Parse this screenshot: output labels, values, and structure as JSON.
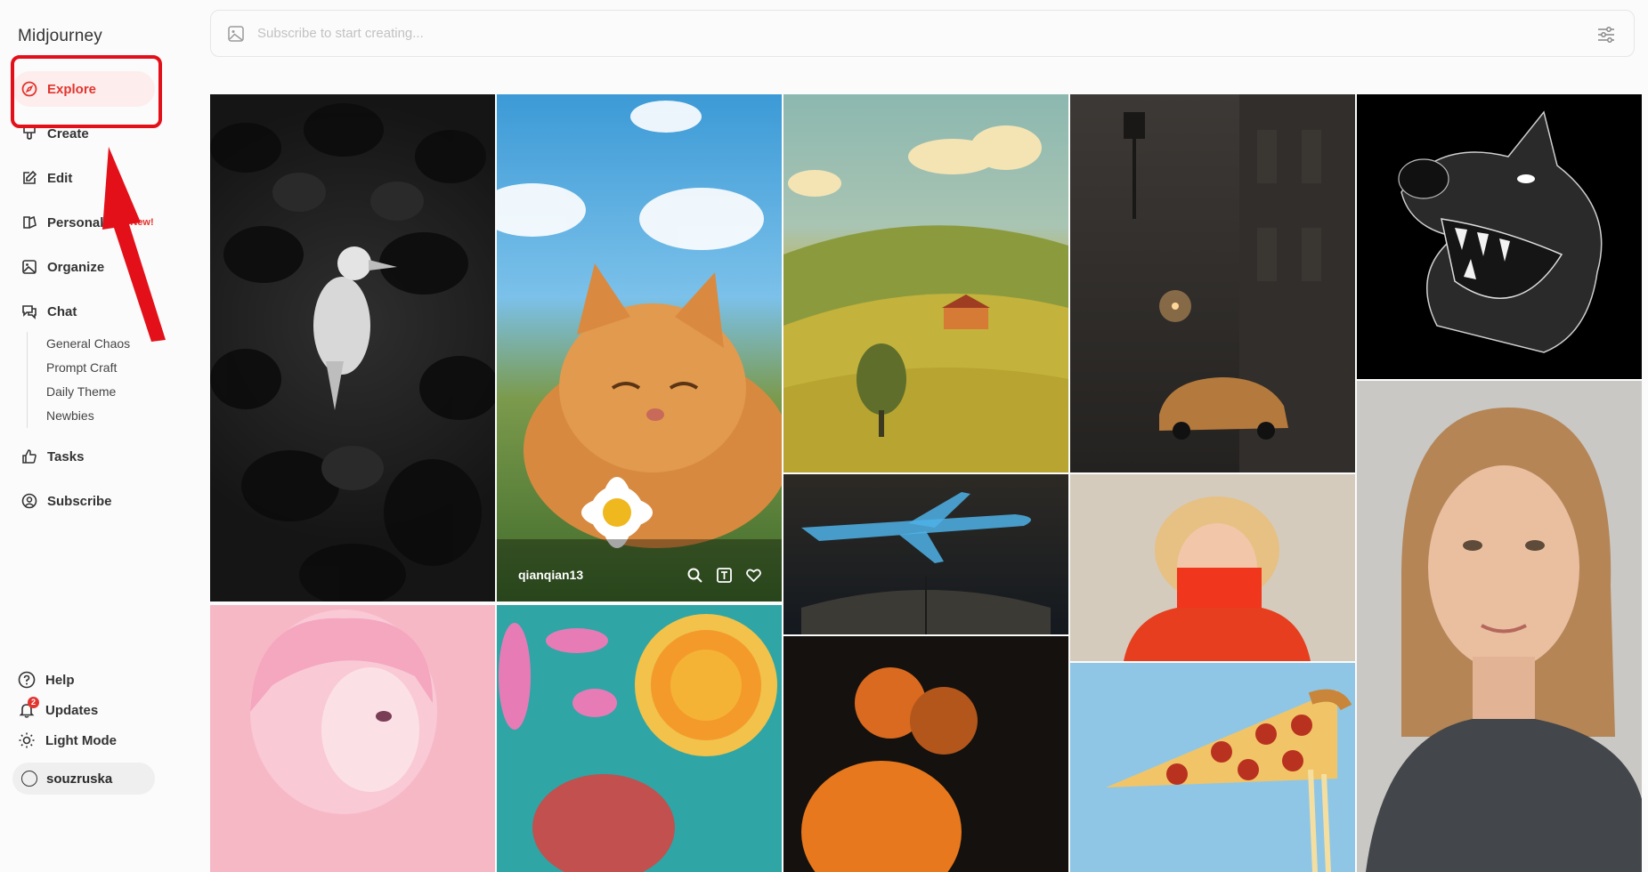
{
  "app": {
    "title": "Midjourney"
  },
  "nav": {
    "explore": "Explore",
    "create": "Create",
    "edit": "Edit",
    "personalize": "Personalize",
    "personalize_badge": "New!",
    "organize": "Organize",
    "chat": "Chat",
    "tasks": "Tasks",
    "subscribe": "Subscribe"
  },
  "chat_channels": [
    "General Chaos",
    "Prompt Craft",
    "Daily Theme",
    "Newbies"
  ],
  "bottom": {
    "help": "Help",
    "updates": "Updates",
    "updates_count": "2",
    "light_mode": "Light Mode",
    "username": "souzruska"
  },
  "search": {
    "placeholder": "Subscribe to start creating..."
  },
  "gallery": {
    "hovered_author": "qianqian13",
    "images": [
      "ravens-white-bird",
      "cat-daisies",
      "countryside-hills",
      "foggy-street-car",
      "wolf-sketch",
      "pink-hair-girl",
      "psychedelic-sun",
      "glowing-airplane-book",
      "woman-red-book",
      "woman-portrait",
      "couple-orange-glow",
      "pizza-slice"
    ]
  },
  "colors": {
    "accent": "#e3352f",
    "active_bg": "#fdeeed",
    "annotation": "#e3101a"
  }
}
